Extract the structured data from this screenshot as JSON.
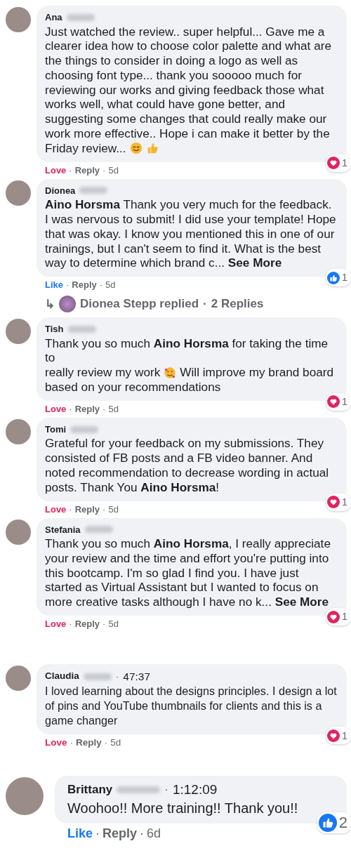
{
  "groups": [
    {
      "comments": [
        {
          "name": "Ana",
          "separator": "·",
          "text": [
            {
              "kind": "line",
              "text": "Just watched the review.. super helpful... Gave me a clearer idea how to choose color palette and what are the things to consider in doing a logo as well as choosing font type... thank you sooooo much for reviewing our works and giving feedback those what works well, what could have gone better, and suggesting some changes that could really make our work more effective.. Hope i can make it better by the"
            },
            {
              "kind": "text",
              "text": "Friday review..."
            },
            {
              "kind": "smile-emoji"
            },
            {
              "kind": "thumbs-up-emoji"
            }
          ],
          "reaction_link": {
            "kind": "love",
            "label": "Love"
          },
          "reply": "Reply",
          "age": "5d",
          "badge": {
            "kind": "love",
            "count": "1"
          }
        },
        {
          "name": "Dionea",
          "separator": "·",
          "text": [
            {
              "kind": "line",
              "text": "**Aino Horsma** Thank you very much for the feedback. I was nervous to submit! I did use your template! Hope that was okay. I know you mentioned this in one of our trainings, but I can't seem to find it. What is the best way to determine which brand c... **See More**"
            }
          ],
          "reaction_link": {
            "kind": "like",
            "label": "Like"
          },
          "reply": "Reply",
          "age": "5d",
          "badge": {
            "kind": "like",
            "count": "1"
          },
          "replies": {
            "arrow": "↳",
            "author": "Dionea Stepp replied",
            "separator": "·",
            "count": "2 Replies"
          }
        },
        {
          "name": "Tish",
          "separator": "·",
          "text": [
            {
              "kind": "line",
              "text": "Thank you so much **Aino Horsma** for taking the time to"
            },
            {
              "kind": "text",
              "text": "really review my work"
            },
            {
              "kind": "hearts-emoji"
            },
            {
              "kind": "text",
              "text": "Will improve my brand board"
            },
            {
              "kind": "line",
              "text": "based on your recommendations"
            }
          ],
          "reaction_link": {
            "kind": "love",
            "label": "Love"
          },
          "reply": "Reply",
          "age": "5d",
          "badge": {
            "kind": "love",
            "count": "1"
          }
        },
        {
          "name": "Tomi",
          "separator": "·",
          "text": [
            {
              "kind": "line",
              "text": "Grateful for your feedback on my submissions. They consisted of FB posts and a FB video banner. And noted recommendation to decrease wording in actual posts. Thank You **Aino Horsma**!"
            }
          ],
          "reaction_link": {
            "kind": "love",
            "label": "Love"
          },
          "reply": "Reply",
          "age": "5d",
          "badge": {
            "kind": "love",
            "count": "1"
          }
        },
        {
          "name": "Stefania",
          "separator": "·",
          "text": [
            {
              "kind": "line",
              "text": "Thank you so much **Aino Horsma**, I really appreciate your review and the time and effort you're putting into this bootcamp. I'm so glad I find you. I have just started as Virtual Assistant but I wanted to focus on more creative tasks although I have no k... **See More**"
            }
          ],
          "reaction_link": {
            "kind": "love",
            "label": "Love"
          },
          "reply": "Reply",
          "age": "5d",
          "badge": {
            "kind": "love",
            "count": "1"
          }
        }
      ]
    },
    {
      "comments": [
        {
          "name": "Claudia",
          "separator": "·",
          "timestamp": "47:37",
          "text": [
            {
              "kind": "line",
              "text": "I loved learning about the designs principles. I design a lot of pins and YouTube thumbnails for clients and this is a game changer"
            }
          ],
          "reaction_link": {
            "kind": "love",
            "label": "Love"
          },
          "reply": "Reply",
          "age": "5d",
          "badge": {
            "kind": "love",
            "count": "1"
          }
        }
      ]
    },
    {
      "comments": [
        {
          "name": "Brittany",
          "separator": "·",
          "timestamp": "1:12:09",
          "text": [
            {
              "kind": "line",
              "text": "Woohoo!! More training!! Thank you!!"
            }
          ],
          "reaction_link": {
            "kind": "like",
            "label": "Like"
          },
          "reply": "Reply",
          "age": "6d",
          "badge": {
            "kind": "like",
            "count": "2"
          }
        }
      ]
    }
  ]
}
